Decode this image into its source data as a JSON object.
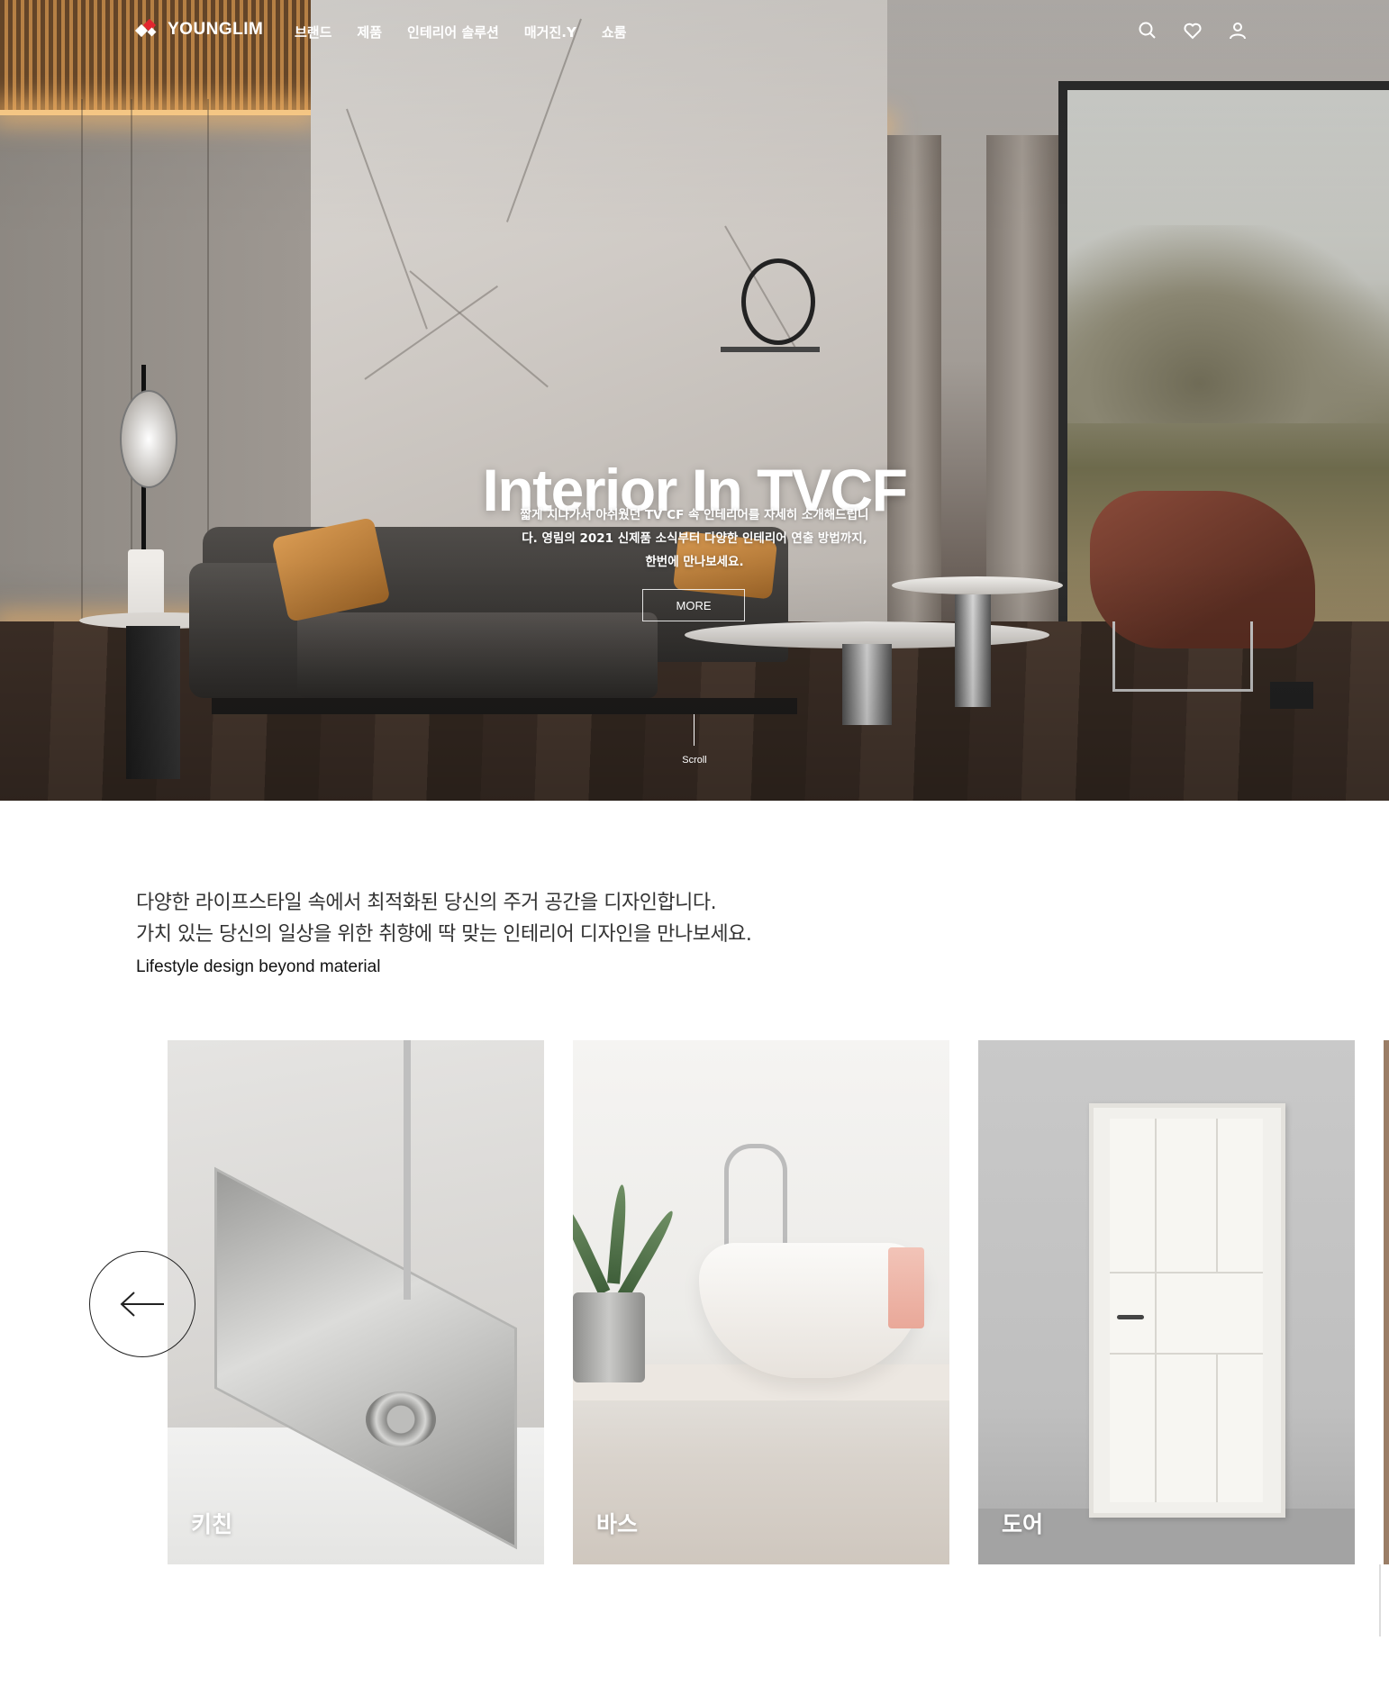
{
  "header": {
    "logo_text": "YOUNGLIM",
    "nav": [
      "브랜드",
      "제품",
      "인테리어 솔루션",
      "매거진.Y",
      "쇼룸"
    ],
    "icons": [
      "search-icon",
      "heart-icon",
      "user-icon"
    ]
  },
  "hero": {
    "title": "Interior In TVCF",
    "description": "짧게 지나가서 아쉬웠던 TV CF 속 인테리어를 자세히 소개해드립니다. 영림의 2021 신제품 소식부터 다양한 인테리어 연출 방법까지, 한번에 만나보세요.",
    "more_label": "MORE",
    "scroll_label": "Scroll"
  },
  "intro": {
    "line1": "다양한 라이프스타일 속에서 최적화된 당신의 주거 공간을 디자인합니다.",
    "line2": "가치 있는 당신의 일상을 위한 취향에 딱 맞는 인테리어 디자인을 만나보세요.",
    "sub": "Lifestyle design beyond material"
  },
  "categories": [
    {
      "label": "키친"
    },
    {
      "label": "바스"
    },
    {
      "label": "도어"
    }
  ],
  "colors": {
    "logo_red": "#e3262f",
    "logo_dark": "#222222",
    "text_dark": "#222222"
  }
}
